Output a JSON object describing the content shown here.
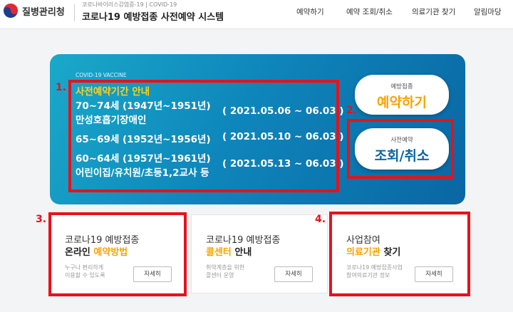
{
  "header": {
    "org": "질병관리청",
    "subtitle": "코로나바이러스감염증-19 | COVID-19",
    "title": "코로나19 예방접종 사전예약 시스템",
    "nav": [
      "예약하기",
      "예약 조회/취소",
      "의료기관 찾기",
      "알림마당"
    ]
  },
  "banner": {
    "tag": "COVID-19 VACCINE",
    "heading": "사전예약기간 안내",
    "rows": [
      {
        "line1": "70~74세 (1947년~1951년)",
        "line2": "만성호흡기장애인",
        "period": "( 2021.05.06 ~ 06.03 )"
      },
      {
        "line1": "65~69세 (1952년~1956년)",
        "period": "( 2021.05.10 ~ 06.03 )"
      },
      {
        "line1": "60~64세 (1957년~1961년)",
        "line2": "어린이집/유치원/초등1,2교사 등",
        "period": "( 2021.05.13 ~ 06.03 )"
      }
    ],
    "reserve": {
      "small": "예방접종",
      "big": "예약하기"
    },
    "lookup": {
      "small": "사전예약",
      "big": "조회/취소"
    }
  },
  "markers": [
    "1.",
    "2.",
    "3.",
    "4."
  ],
  "cards": [
    {
      "h1": "코로나19 예방접종",
      "h2_a": "온라인",
      "h2_b": "예약방법",
      "d1": "누구나 편리하게",
      "d2": "이용할 수 있도록",
      "btn": "자세히"
    },
    {
      "h1": "코로나19 예방접종",
      "h2_a": "콜센터",
      "h2_b": "안내",
      "d1": "취약계층을 위한",
      "d2": "콜센터 운영",
      "btn": "자세히"
    },
    {
      "h1": "사업참여",
      "h2_a": "의료기관",
      "h2_b": "찾기",
      "d1": "코로나19 예방접종사업",
      "d2": "참여의료기관 정보",
      "btn": "자세히"
    }
  ],
  "colors": {
    "accent_red": "#e8111a",
    "highlight_yellow": "#ffd21f",
    "highlight_orange": "#f5a400",
    "banner_blue": "#0e86bb",
    "brand_navy": "#1b3f8f"
  },
  "icons": {
    "logo": "kdca-taeguk-logo"
  }
}
